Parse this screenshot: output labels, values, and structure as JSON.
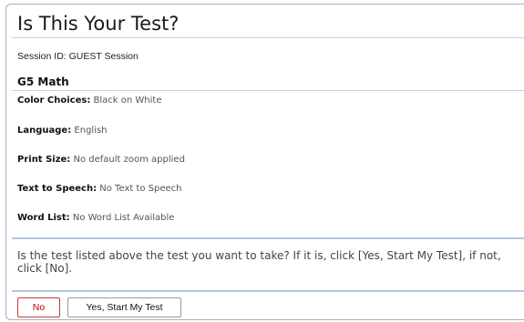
{
  "dialog": {
    "title": "Is This Your Test?",
    "session_label": "Session ID: GUEST Session",
    "test_name": "G5 Math",
    "settings": [
      {
        "label": "Color Choices:",
        "value": "Black on White"
      },
      {
        "label": "Language:",
        "value": "English"
      },
      {
        "label": "Print Size:",
        "value": "No default zoom applied"
      },
      {
        "label": "Text to Speech:",
        "value": "No Text to Speech"
      },
      {
        "label": "Word List:",
        "value": "No Word List Available"
      }
    ],
    "prompt": "Is the test listed above the test you want to take? If it is, click [Yes, Start My Test], if not, click [No].",
    "buttons": {
      "no": "No",
      "yes": "Yes, Start My Test"
    }
  },
  "colors": {
    "border": "#9fb3c8",
    "rule": "#c5d3e0",
    "no_button": "#c00000"
  }
}
